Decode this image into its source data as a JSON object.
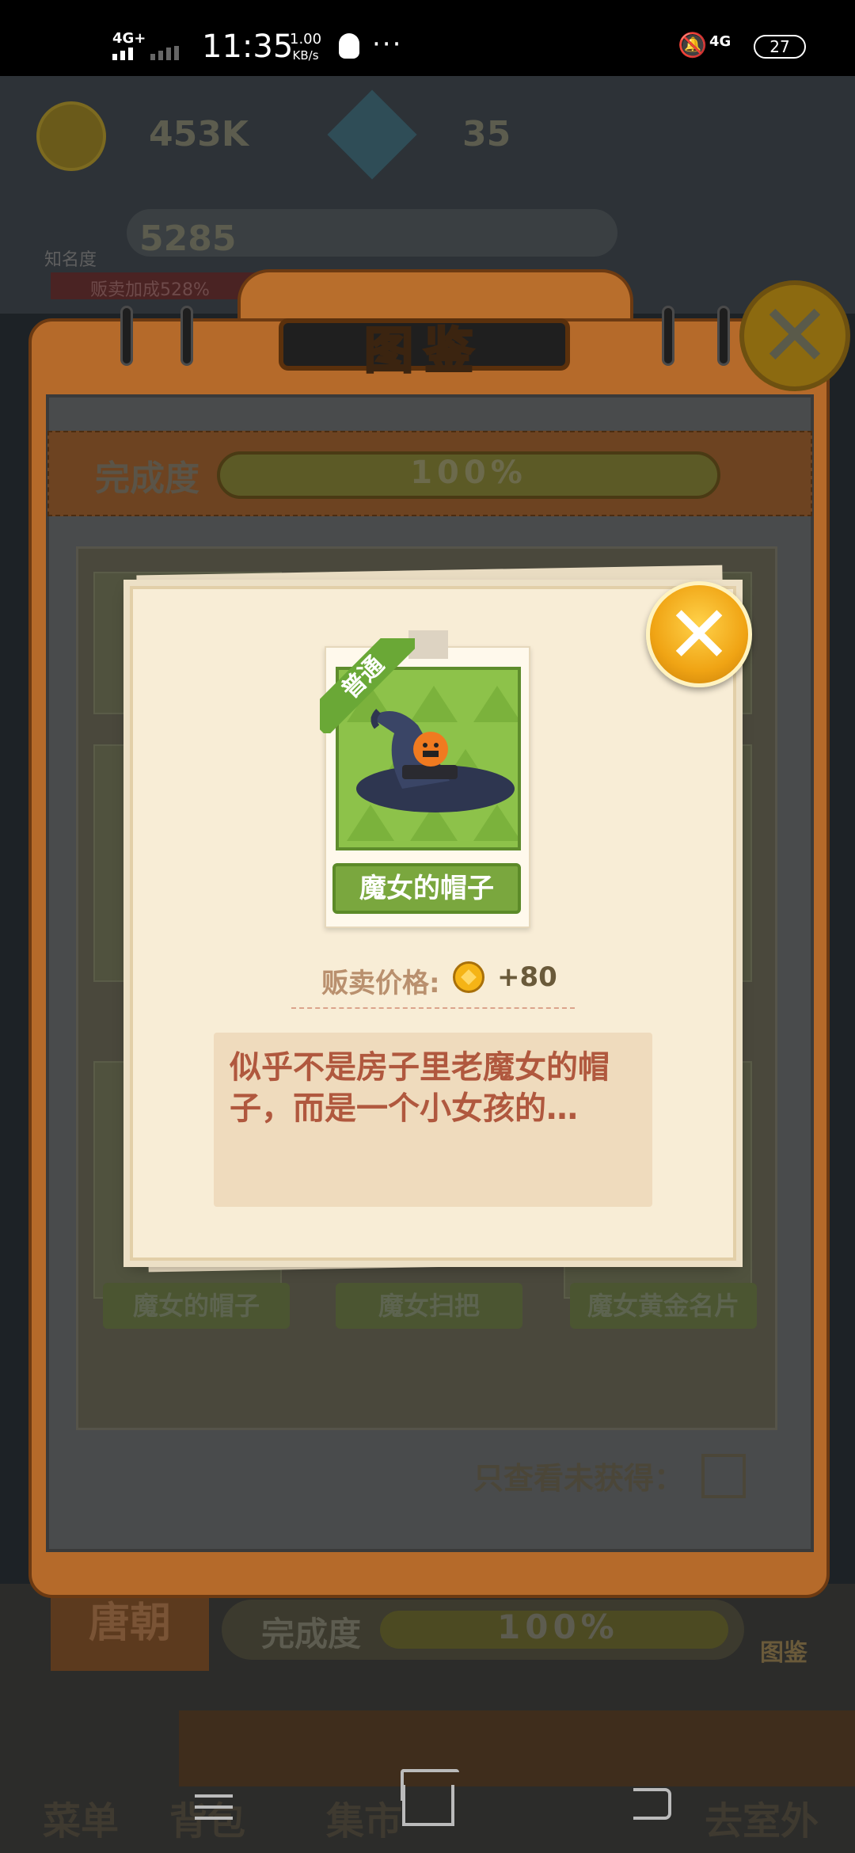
{
  "status_bar": {
    "network": "4G+",
    "time": "11:35",
    "speed_value": "1.00",
    "speed_unit": "KB/s",
    "dots": "···",
    "network2": "4G",
    "battery": "27"
  },
  "background": {
    "coins": "453K",
    "gems": "35",
    "fame_label": "知名度",
    "fame_value": "5285",
    "sale_bonus": "贩卖加成528%",
    "era": "唐朝",
    "completion_label": "完成度",
    "completion_value": "100%",
    "book_label": "图鉴",
    "tabs": [
      "菜单",
      "背包",
      "集市",
      "去室外"
    ]
  },
  "book": {
    "title": "图鉴",
    "completion_label": "完成度",
    "completion_value": "100%",
    "card_names": [
      "魔女的帽子",
      "魔女扫把",
      "魔女黄金名片"
    ],
    "filter_label": "只查看未获得："
  },
  "popup": {
    "rarity": "普通",
    "item_name": "魔女的帽子",
    "price_label": "贩卖价格:",
    "price_value": "+80",
    "description": "似乎不是房子里老魔女的帽子，而是一个小女孩的…"
  }
}
